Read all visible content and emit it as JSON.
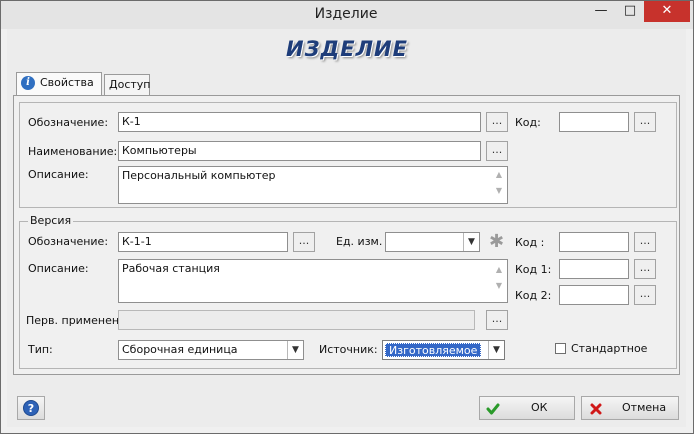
{
  "window": {
    "title": "Изделие",
    "heading": "ИЗДЕЛИЕ",
    "controls": {
      "minimize": "—",
      "maximize": "□",
      "close": "✕"
    }
  },
  "tabs": [
    {
      "label": "Свойства",
      "icon": "info-icon",
      "active": true
    },
    {
      "label": "Доступ",
      "active": false
    }
  ],
  "properties": {
    "designation_label": "Обозначение:",
    "designation_value": "К-1",
    "code_label": "Код:",
    "code_value": "",
    "name_label": "Наименование:",
    "name_value": "Компьютеры",
    "description_label": "Описание:",
    "description_value": "Персональный компьютер",
    "ellipsis": "..."
  },
  "version": {
    "group_label": "Версия",
    "designation_label": "Обозначение:",
    "designation_value": "К-1-1",
    "unit_label": "Ед. изм.",
    "unit_value": "",
    "required_mark": "✱",
    "code_label": "Код :",
    "code1_label": "Код 1:",
    "code2_label": "Код 2:",
    "description_label": "Описание:",
    "description_value": "Рабочая станция",
    "first_use_label": "Перв. применен.",
    "first_use_value": "",
    "type_label": "Тип:",
    "type_value": "Сборочная единица",
    "source_label": "Источник:",
    "source_value": "Изготовляемое",
    "standard_label": "Стандартное",
    "standard_checked": false
  },
  "footer": {
    "help": "?",
    "ok_label": "ОК",
    "cancel_label": "Отмена"
  },
  "colors": {
    "heading": "#1e3d7a",
    "selection": "#3367c7",
    "ok_check": "#2a9a2a",
    "cancel_x": "#d01818"
  }
}
